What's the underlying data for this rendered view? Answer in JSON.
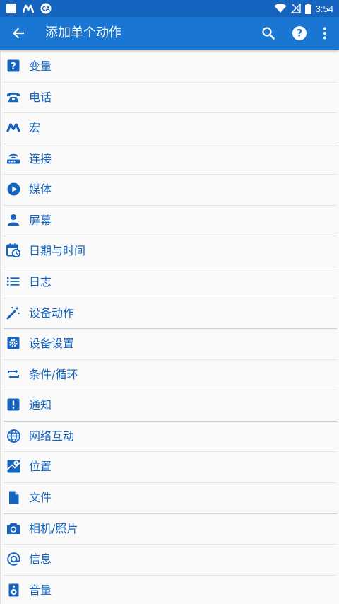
{
  "status_bar": {
    "time": "3:54",
    "icons": [
      "square-notification-icon",
      "macrodroid-m-icon",
      "ca-notification-icon",
      "wifi-icon",
      "no-signal-icon",
      "battery-icon"
    ]
  },
  "app_bar": {
    "title": "添加单个动作",
    "icons": [
      "back-arrow-icon",
      "search-icon",
      "help-icon",
      "more-vert-icon"
    ]
  },
  "colors": {
    "status_bar": "#1565c0",
    "app_bar": "#1976d2",
    "accent": "#1565c0"
  },
  "categories": [
    {
      "label": "变量",
      "icon": "variable-question-icon"
    },
    {
      "label": "电话",
      "icon": "phone-icon"
    },
    {
      "label": "宏",
      "icon": "macro-m-icon"
    },
    {
      "label": "连接",
      "icon": "router-icon"
    },
    {
      "label": "媒体",
      "icon": "play-circle-icon"
    },
    {
      "label": "屏幕",
      "icon": "person-icon"
    },
    {
      "label": "日期与时间",
      "icon": "calendar-clock-icon"
    },
    {
      "label": "日志",
      "icon": "list-icon"
    },
    {
      "label": "设备动作",
      "icon": "magic-wand-icon"
    },
    {
      "label": "设备设置",
      "icon": "settings-gear-icon"
    },
    {
      "label": "条件/循环",
      "icon": "repeat-icon"
    },
    {
      "label": "通知",
      "icon": "alert-icon"
    },
    {
      "label": "网络互动",
      "icon": "globe-icon"
    },
    {
      "label": "位置",
      "icon": "map-location-icon"
    },
    {
      "label": "文件",
      "icon": "file-icon"
    },
    {
      "label": "相机/照片",
      "icon": "camera-icon"
    },
    {
      "label": "信息",
      "icon": "at-sign-icon"
    },
    {
      "label": "音量",
      "icon": "speaker-icon"
    }
  ]
}
